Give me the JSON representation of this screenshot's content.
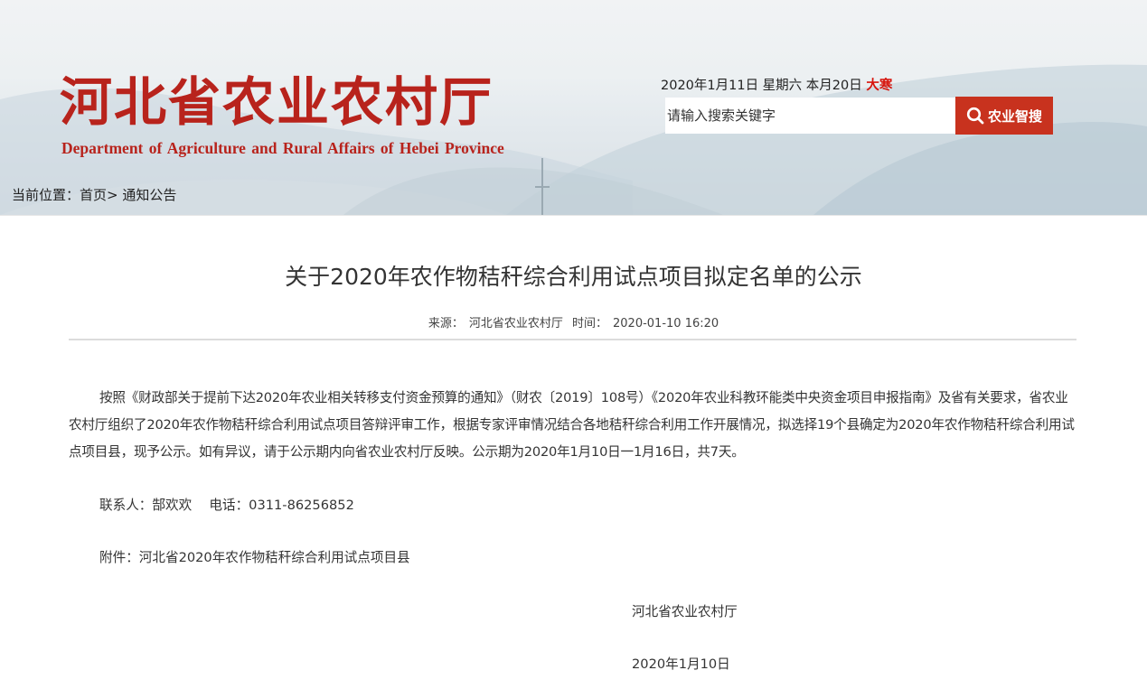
{
  "header": {
    "logo_cn": "河北省农业农村厅",
    "logo_en": "Department of Agriculture and Rural Affairs of Hebei Province",
    "date_text": "2020年1月11日 星期六 本月20日",
    "solar_term": "大寒",
    "search": {
      "placeholder": "请输入搜索关键字",
      "button_label": "农业智搜"
    }
  },
  "breadcrumb": {
    "prefix": "当前位置：",
    "home": "首页",
    "separator": ">",
    "current": "通知公告"
  },
  "article": {
    "title": "关于2020年农作物秸秆综合利用试点项目拟定名单的公示",
    "source_label": "来源：",
    "source": "河北省农业农村厅",
    "time_label": "时间：",
    "time": "2020-01-10 16:20",
    "body": "按照《财政部关于提前下达2020年农业相关转移支付资金预算的通知》（财农〔2019〕108号）《2020年农业科教环能类中央资金项目申报指南》及省有关要求，省农业农村厅组织了2020年农作物秸秆综合利用试点项目答辩评审工作，根据专家评审情况结合各地秸秆综合利用工作开展情况，拟选择19个县确定为2020年农作物秸秆综合利用试点项目县，现予公示。如有异议，请于公示期内向省农业农村厅反映。公示期为2020年1月10日一1月16日，共7天。",
    "contact": "联系人：郜欢欢　 电话：0311-86256852",
    "attachment_label": "附件：",
    "attachment": "河北省2020年农作物秸秆综合利用试点项目县",
    "signature_org": "河北省农业农村厅",
    "signature_date": "2020年1月10日"
  },
  "colors": {
    "brand_red": "#b8231c",
    "search_button": "#c8321e",
    "solar_term": "#d7140c"
  }
}
